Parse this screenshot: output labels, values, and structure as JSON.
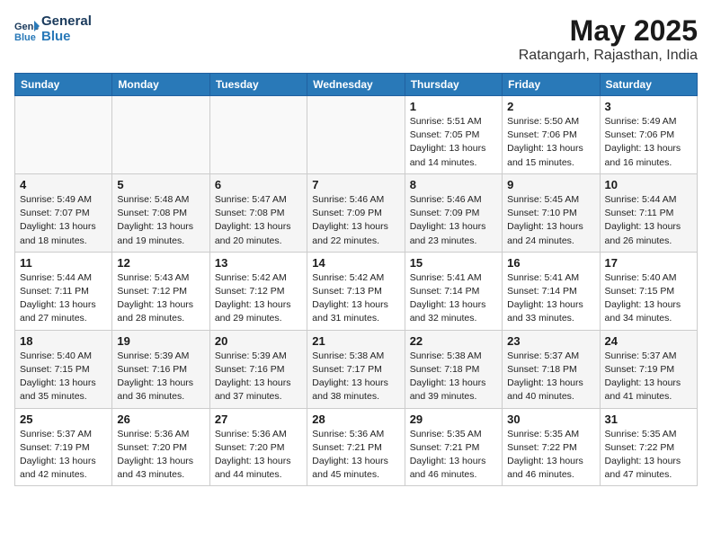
{
  "logo": {
    "line1": "General",
    "line2": "Blue"
  },
  "title": "May 2025",
  "subtitle": "Ratangarh, Rajasthan, India",
  "weekdays": [
    "Sunday",
    "Monday",
    "Tuesday",
    "Wednesday",
    "Thursday",
    "Friday",
    "Saturday"
  ],
  "weeks": [
    [
      {
        "day": "",
        "info": ""
      },
      {
        "day": "",
        "info": ""
      },
      {
        "day": "",
        "info": ""
      },
      {
        "day": "",
        "info": ""
      },
      {
        "day": "1",
        "info": "Sunrise: 5:51 AM\nSunset: 7:05 PM\nDaylight: 13 hours\nand 14 minutes."
      },
      {
        "day": "2",
        "info": "Sunrise: 5:50 AM\nSunset: 7:06 PM\nDaylight: 13 hours\nand 15 minutes."
      },
      {
        "day": "3",
        "info": "Sunrise: 5:49 AM\nSunset: 7:06 PM\nDaylight: 13 hours\nand 16 minutes."
      }
    ],
    [
      {
        "day": "4",
        "info": "Sunrise: 5:49 AM\nSunset: 7:07 PM\nDaylight: 13 hours\nand 18 minutes."
      },
      {
        "day": "5",
        "info": "Sunrise: 5:48 AM\nSunset: 7:08 PM\nDaylight: 13 hours\nand 19 minutes."
      },
      {
        "day": "6",
        "info": "Sunrise: 5:47 AM\nSunset: 7:08 PM\nDaylight: 13 hours\nand 20 minutes."
      },
      {
        "day": "7",
        "info": "Sunrise: 5:46 AM\nSunset: 7:09 PM\nDaylight: 13 hours\nand 22 minutes."
      },
      {
        "day": "8",
        "info": "Sunrise: 5:46 AM\nSunset: 7:09 PM\nDaylight: 13 hours\nand 23 minutes."
      },
      {
        "day": "9",
        "info": "Sunrise: 5:45 AM\nSunset: 7:10 PM\nDaylight: 13 hours\nand 24 minutes."
      },
      {
        "day": "10",
        "info": "Sunrise: 5:44 AM\nSunset: 7:11 PM\nDaylight: 13 hours\nand 26 minutes."
      }
    ],
    [
      {
        "day": "11",
        "info": "Sunrise: 5:44 AM\nSunset: 7:11 PM\nDaylight: 13 hours\nand 27 minutes."
      },
      {
        "day": "12",
        "info": "Sunrise: 5:43 AM\nSunset: 7:12 PM\nDaylight: 13 hours\nand 28 minutes."
      },
      {
        "day": "13",
        "info": "Sunrise: 5:42 AM\nSunset: 7:12 PM\nDaylight: 13 hours\nand 29 minutes."
      },
      {
        "day": "14",
        "info": "Sunrise: 5:42 AM\nSunset: 7:13 PM\nDaylight: 13 hours\nand 31 minutes."
      },
      {
        "day": "15",
        "info": "Sunrise: 5:41 AM\nSunset: 7:14 PM\nDaylight: 13 hours\nand 32 minutes."
      },
      {
        "day": "16",
        "info": "Sunrise: 5:41 AM\nSunset: 7:14 PM\nDaylight: 13 hours\nand 33 minutes."
      },
      {
        "day": "17",
        "info": "Sunrise: 5:40 AM\nSunset: 7:15 PM\nDaylight: 13 hours\nand 34 minutes."
      }
    ],
    [
      {
        "day": "18",
        "info": "Sunrise: 5:40 AM\nSunset: 7:15 PM\nDaylight: 13 hours\nand 35 minutes."
      },
      {
        "day": "19",
        "info": "Sunrise: 5:39 AM\nSunset: 7:16 PM\nDaylight: 13 hours\nand 36 minutes."
      },
      {
        "day": "20",
        "info": "Sunrise: 5:39 AM\nSunset: 7:16 PM\nDaylight: 13 hours\nand 37 minutes."
      },
      {
        "day": "21",
        "info": "Sunrise: 5:38 AM\nSunset: 7:17 PM\nDaylight: 13 hours\nand 38 minutes."
      },
      {
        "day": "22",
        "info": "Sunrise: 5:38 AM\nSunset: 7:18 PM\nDaylight: 13 hours\nand 39 minutes."
      },
      {
        "day": "23",
        "info": "Sunrise: 5:37 AM\nSunset: 7:18 PM\nDaylight: 13 hours\nand 40 minutes."
      },
      {
        "day": "24",
        "info": "Sunrise: 5:37 AM\nSunset: 7:19 PM\nDaylight: 13 hours\nand 41 minutes."
      }
    ],
    [
      {
        "day": "25",
        "info": "Sunrise: 5:37 AM\nSunset: 7:19 PM\nDaylight: 13 hours\nand 42 minutes."
      },
      {
        "day": "26",
        "info": "Sunrise: 5:36 AM\nSunset: 7:20 PM\nDaylight: 13 hours\nand 43 minutes."
      },
      {
        "day": "27",
        "info": "Sunrise: 5:36 AM\nSunset: 7:20 PM\nDaylight: 13 hours\nand 44 minutes."
      },
      {
        "day": "28",
        "info": "Sunrise: 5:36 AM\nSunset: 7:21 PM\nDaylight: 13 hours\nand 45 minutes."
      },
      {
        "day": "29",
        "info": "Sunrise: 5:35 AM\nSunset: 7:21 PM\nDaylight: 13 hours\nand 46 minutes."
      },
      {
        "day": "30",
        "info": "Sunrise: 5:35 AM\nSunset: 7:22 PM\nDaylight: 13 hours\nand 46 minutes."
      },
      {
        "day": "31",
        "info": "Sunrise: 5:35 AM\nSunset: 7:22 PM\nDaylight: 13 hours\nand 47 minutes."
      }
    ]
  ]
}
